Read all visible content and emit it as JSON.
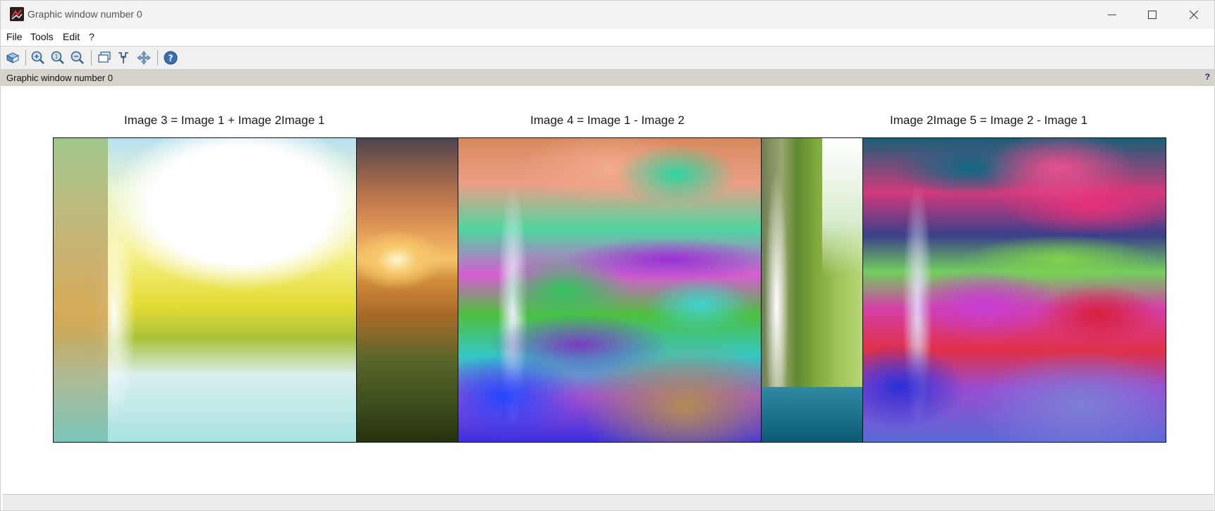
{
  "window": {
    "title": "Graphic window number 0",
    "controls": {
      "minimize_icon": "minimize-icon",
      "maximize_icon": "maximize-icon",
      "close_icon": "close-icon"
    }
  },
  "menu": {
    "items": [
      {
        "label": "File"
      },
      {
        "label": "Tools"
      },
      {
        "label": "Edit"
      },
      {
        "label": "?"
      }
    ]
  },
  "toolbar": {
    "tools": [
      {
        "icon": "rotate-icon"
      },
      {
        "icon": "zoom-icon"
      },
      {
        "icon": "zoom-region-icon"
      },
      {
        "icon": "unzoom-icon"
      },
      {
        "icon": "datatip-icon"
      },
      {
        "icon": "datatip-select-icon"
      },
      {
        "icon": "pan-icon"
      },
      {
        "icon": "help-icon"
      }
    ]
  },
  "infobar": {
    "text": "Graphic window number 0",
    "help": "?"
  },
  "canvas": {
    "titles": [
      "Image 3 = Image 1 + Image 2Image 1",
      "Image 4 = Image 1 - Image 2",
      "Image 2Image 5 = Image 2 - Image 1"
    ],
    "images": [
      {
        "name": "Image 3"
      },
      {
        "name": "Image 1"
      },
      {
        "name": "Image 4"
      },
      {
        "name": "Image 2"
      },
      {
        "name": "Image 5"
      }
    ]
  },
  "colors": {
    "titlebar": "#f3f3f3",
    "infobar": "#d6d2cc",
    "toolbar": "#f0f0f0"
  }
}
